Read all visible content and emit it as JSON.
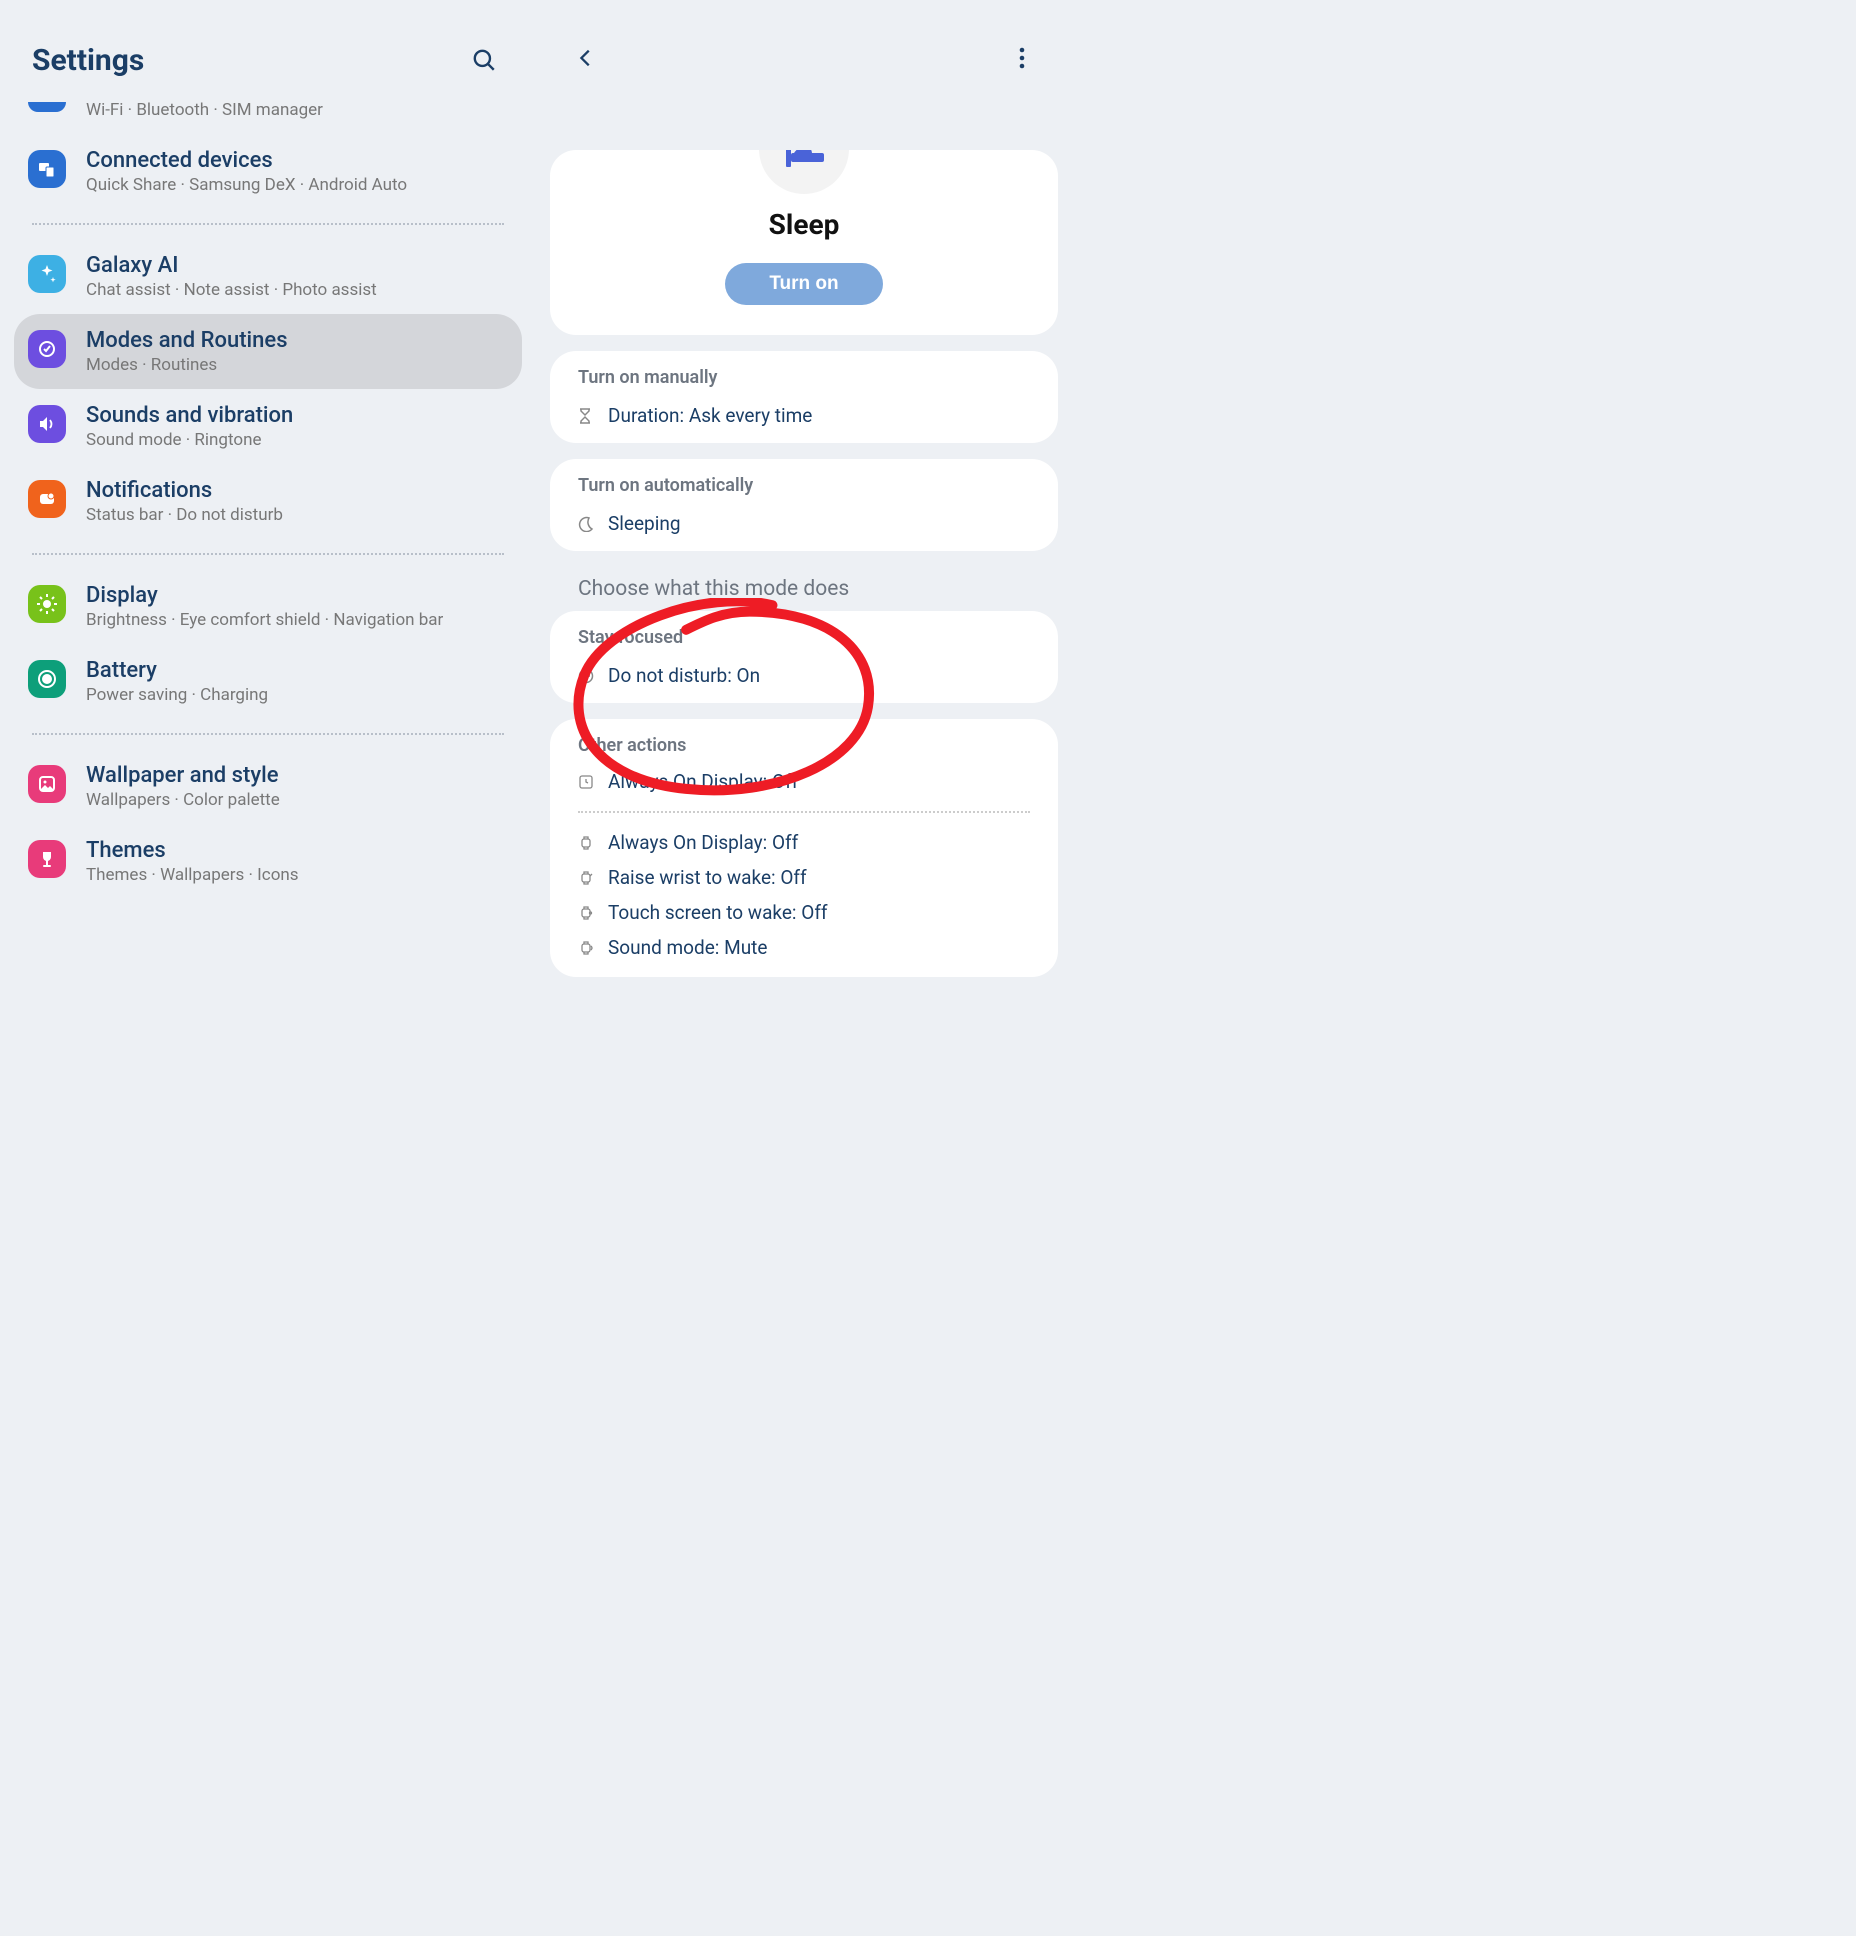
{
  "left": {
    "title": "Settings",
    "items": [
      {
        "id": "connections-partial",
        "subtitle": "Wi-Fi  ·  Bluetooth  ·  SIM manager",
        "iconColor": "#2a6fd1"
      },
      {
        "id": "connected-devices",
        "title": "Connected devices",
        "subtitle": "Quick Share  ·  Samsung DeX  ·  Android Auto",
        "iconColor": "#2a6fd1"
      },
      null,
      {
        "id": "galaxy-ai",
        "title": "Galaxy AI",
        "subtitle": "Chat assist  ·  Note assist  ·  Photo assist",
        "iconColor": "#3db0e4"
      },
      {
        "id": "modes-routines",
        "title": "Modes and Routines",
        "subtitle": "Modes  ·  Routines",
        "iconColor": "#6d4ee0",
        "selected": true
      },
      {
        "id": "sounds-vibration",
        "title": "Sounds and vibration",
        "subtitle": "Sound mode  ·  Ringtone",
        "iconColor": "#6d4ee0"
      },
      {
        "id": "notifications",
        "title": "Notifications",
        "subtitle": "Status bar  ·  Do not disturb",
        "iconColor": "#f0631c"
      },
      null,
      {
        "id": "display",
        "title": "Display",
        "subtitle": "Brightness  ·  Eye comfort shield  ·  Navigation bar",
        "iconColor": "#78c21a"
      },
      {
        "id": "battery",
        "title": "Battery",
        "subtitle": "Power saving  ·  Charging",
        "iconColor": "#0d9f7a"
      },
      null,
      {
        "id": "wallpaper-style",
        "title": "Wallpaper and style",
        "subtitle": "Wallpapers  ·  Color palette",
        "iconColor": "#e83b7a"
      },
      {
        "id": "themes",
        "title": "Themes",
        "subtitle": "Themes  ·  Wallpapers  ·  Icons",
        "iconColor": "#e83b7a"
      }
    ]
  },
  "right": {
    "mode_title": "Sleep",
    "turn_on_label": "Turn on",
    "manual": {
      "header": "Turn on manually",
      "duration_label": "Duration: Ask every time"
    },
    "auto": {
      "header": "Turn on automatically",
      "trigger_label": "Sleeping"
    },
    "choose_header": "Choose what this mode does",
    "stay_focused": {
      "header": "Stay focused",
      "dnd_label": "Do not disturb: On"
    },
    "other_actions": {
      "header": "Other actions",
      "group1": [
        "Always On Display: Off"
      ],
      "group2": [
        "Always On Display: Off",
        "Raise wrist to wake: Off",
        "Touch screen to wake: Off",
        "Sound mode: Mute"
      ]
    }
  }
}
